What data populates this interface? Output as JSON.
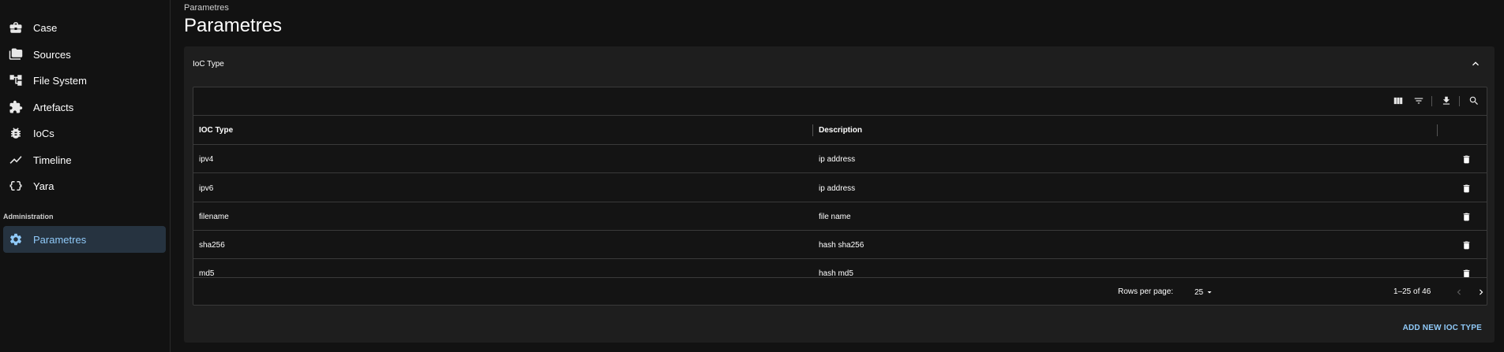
{
  "sidebar": {
    "items": [
      {
        "label": "Case",
        "icon": "briefcase-icon"
      },
      {
        "label": "Sources",
        "icon": "folders-icon"
      },
      {
        "label": "File System",
        "icon": "account-tree-icon"
      },
      {
        "label": "Artefacts",
        "icon": "puzzle-icon"
      },
      {
        "label": "IoCs",
        "icon": "bug-icon"
      },
      {
        "label": "Timeline",
        "icon": "timeline-icon"
      },
      {
        "label": "Yara",
        "icon": "data-object-icon"
      }
    ],
    "admin_header": "Administration",
    "admin_items": [
      {
        "label": "Parametres",
        "icon": "gear-icon",
        "active": true
      }
    ]
  },
  "header": {
    "breadcrumb": "Parametres",
    "title": "Parametres"
  },
  "panel": {
    "title": "IoC Type",
    "add_button": "ADD NEW IOC TYPE"
  },
  "table": {
    "columns": [
      "IOC Type",
      "Description"
    ],
    "rows": [
      {
        "type": "ipv4",
        "description": "ip address"
      },
      {
        "type": "ipv6",
        "description": "ip address"
      },
      {
        "type": "filename",
        "description": "file name"
      },
      {
        "type": "sha256",
        "description": "hash sha256"
      },
      {
        "type": "md5",
        "description": "hash md5"
      }
    ],
    "pagination": {
      "rows_per_page_label": "Rows per page:",
      "rows_per_page": "25",
      "range": "1–25 of 46"
    }
  },
  "colors": {
    "accent": "#90caf9",
    "background": "#121212",
    "surface": "#1e1e1e",
    "active_nav_bg": "#263340"
  }
}
